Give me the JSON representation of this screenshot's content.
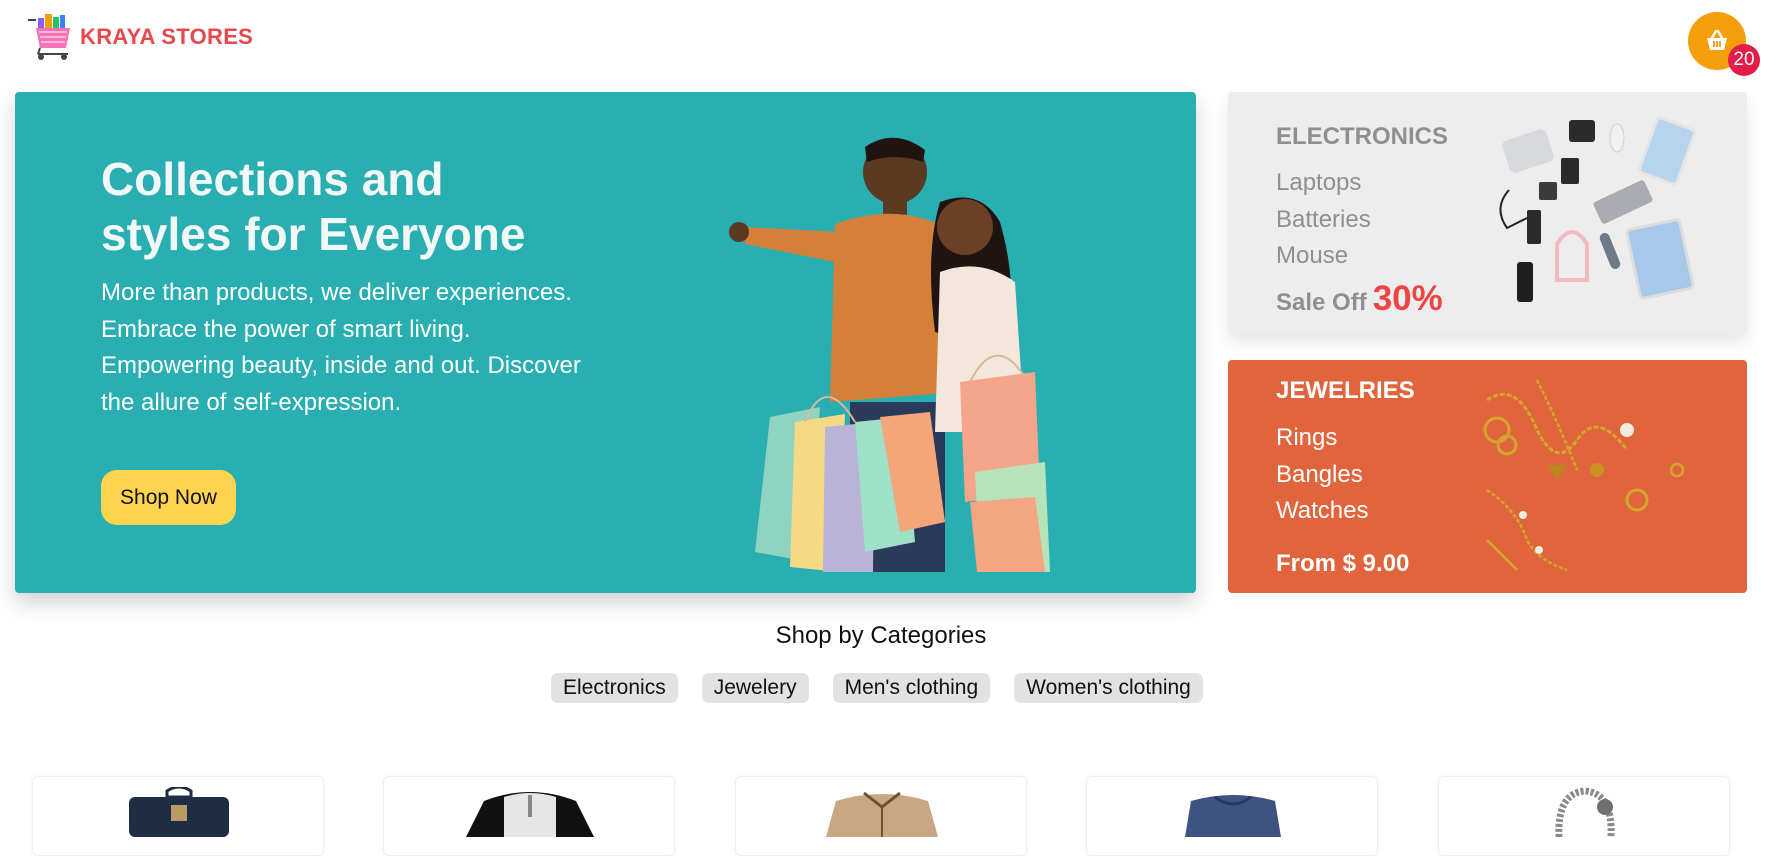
{
  "brand": {
    "name": "KRAYA STORES",
    "icon": "shopping-cart-logo"
  },
  "cart": {
    "icon": "basket-icon",
    "count": "20"
  },
  "hero": {
    "title": "Collections and styles for Everyone",
    "description": "More than products, we deliver experiences. Embrace the power of smart living. Empowering beauty, inside and out. Discover the allure of self-expression.",
    "cta": "Shop Now"
  },
  "electronics": {
    "title": "ELECTRONICS",
    "items": [
      "Laptops",
      "Batteries",
      "Mouse"
    ],
    "sale_label": "Sale Off",
    "sale_value": "30%"
  },
  "jewelries": {
    "title": "JEWELRIES",
    "items": [
      "Rings",
      "Bangles",
      "Watches"
    ],
    "price": "From $ 9.00"
  },
  "categories": {
    "title": "Shop by Categories",
    "items": [
      "Electronics",
      "Jewelery",
      "Men's clothing",
      "Women's clothing"
    ]
  },
  "products": [
    {
      "icon": "backpack-image"
    },
    {
      "icon": "henley-shirt-image"
    },
    {
      "icon": "jacket-image"
    },
    {
      "icon": "tshirt-image"
    },
    {
      "icon": "bracelet-image"
    }
  ],
  "colors": {
    "brand": "#e5484d",
    "hero_bg": "#29aeb2",
    "cta": "#fdd44e",
    "cart": "#f59e0b",
    "badge": "#e11d48",
    "jewelry_bg": "#e0653c",
    "sale": "#ef4444"
  }
}
